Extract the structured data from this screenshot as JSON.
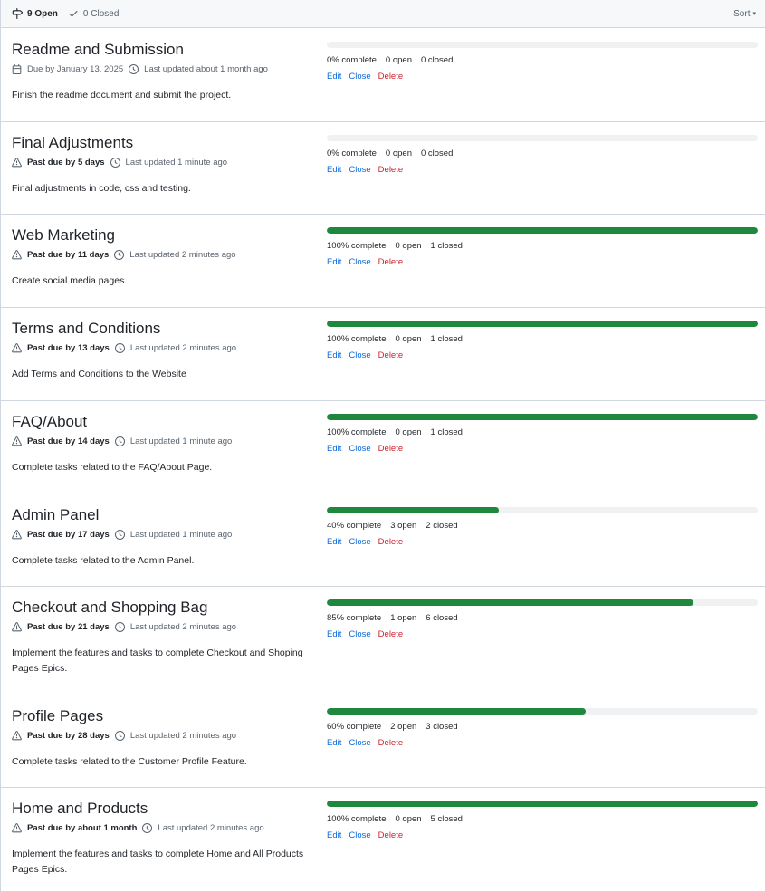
{
  "header": {
    "open_label": "9 Open",
    "closed_label": "0 Closed",
    "sort_label": "Sort"
  },
  "actions": {
    "edit": "Edit",
    "close": "Close",
    "delete": "Delete"
  },
  "milestones": [
    {
      "title": "Readme and Submission",
      "due_icon": "calendar-icon",
      "due": "Due by January 13, 2025",
      "updated": "Last updated about 1 month ago",
      "description": "Finish the readme document and submit the project.",
      "progress": 0,
      "complete": "0% complete",
      "open": "0 open",
      "closed": "0 closed"
    },
    {
      "title": "Final Adjustments",
      "due_icon": "alert-icon",
      "due": "Past due by 5 days",
      "updated": "Last updated 1 minute ago",
      "description": "Final adjustments in code, css and testing.",
      "progress": 0,
      "complete": "0% complete",
      "open": "0 open",
      "closed": "0 closed"
    },
    {
      "title": "Web Marketing",
      "due_icon": "alert-icon",
      "due": "Past due by 11 days",
      "updated": "Last updated 2 minutes ago",
      "description": "Create social media pages.",
      "progress": 100,
      "complete": "100% complete",
      "open": "0 open",
      "closed": "1 closed"
    },
    {
      "title": "Terms and Conditions",
      "due_icon": "alert-icon",
      "due": "Past due by 13 days",
      "updated": "Last updated 2 minutes ago",
      "description": "Add Terms and Conditions to the Website",
      "progress": 100,
      "complete": "100% complete",
      "open": "0 open",
      "closed": "1 closed"
    },
    {
      "title": "FAQ/About",
      "due_icon": "alert-icon",
      "due": "Past due by 14 days",
      "updated": "Last updated 1 minute ago",
      "description": "Complete tasks related to the FAQ/About Page.",
      "progress": 100,
      "complete": "100% complete",
      "open": "0 open",
      "closed": "1 closed"
    },
    {
      "title": "Admin Panel",
      "due_icon": "alert-icon",
      "due": "Past due by 17 days",
      "updated": "Last updated 1 minute ago",
      "description": "Complete tasks related to the Admin Panel.",
      "progress": 40,
      "complete": "40% complete",
      "open": "3 open",
      "closed": "2 closed"
    },
    {
      "title": "Checkout and Shopping Bag",
      "due_icon": "alert-icon",
      "due": "Past due by 21 days",
      "updated": "Last updated 2 minutes ago",
      "description": "Implement the features and tasks to complete Checkout and Shoping Pages Epics.",
      "progress": 85,
      "complete": "85% complete",
      "open": "1 open",
      "closed": "6 closed"
    },
    {
      "title": "Profile Pages",
      "due_icon": "alert-icon",
      "due": "Past due by 28 days",
      "updated": "Last updated 2 minutes ago",
      "description": "Complete tasks related to the Customer Profile Feature.",
      "progress": 60,
      "complete": "60% complete",
      "open": "2 open",
      "closed": "3 closed"
    },
    {
      "title": "Home and Products",
      "due_icon": "alert-icon",
      "due": "Past due by about 1 month",
      "updated": "Last updated 2 minutes ago",
      "description": "Implement the features and tasks to complete Home and All Products Pages Epics.",
      "progress": 100,
      "complete": "100% complete",
      "open": "0 open",
      "closed": "5 closed"
    }
  ],
  "colors": {
    "progress": "#1f883d",
    "track": "#eff1f3",
    "link": "#0969da",
    "danger": "#cf222e"
  }
}
